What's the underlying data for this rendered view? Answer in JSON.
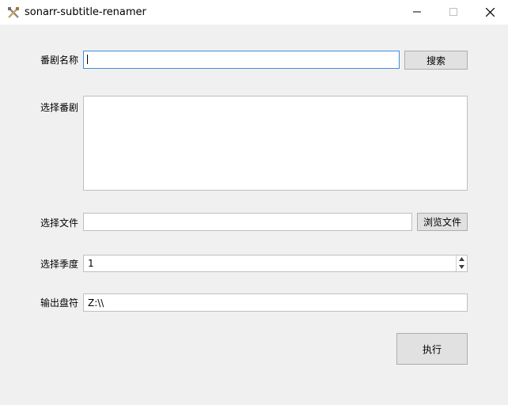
{
  "window": {
    "title": "sonarr-subtitle-renamer",
    "icon": "crossed-tools-icon",
    "controls": [
      "minimize-icon",
      "maximize-icon",
      "close-icon"
    ]
  },
  "form": {
    "series_name": {
      "label": "番剧名称",
      "value": "",
      "search_button": "搜索"
    },
    "select_series": {
      "label": "选择番剧",
      "items": []
    },
    "select_file": {
      "label": "选择文件",
      "value": "",
      "browse_button": "浏览文件"
    },
    "select_season": {
      "label": "选择季度",
      "value": "1"
    },
    "output_drive": {
      "label": "输出盘符",
      "value": "Z:\\\\"
    },
    "execute_button": "执行"
  },
  "colors": {
    "background": "#f0f0f0",
    "focus_border": "#3c8fdc",
    "button_face": "#e1e1e1"
  }
}
